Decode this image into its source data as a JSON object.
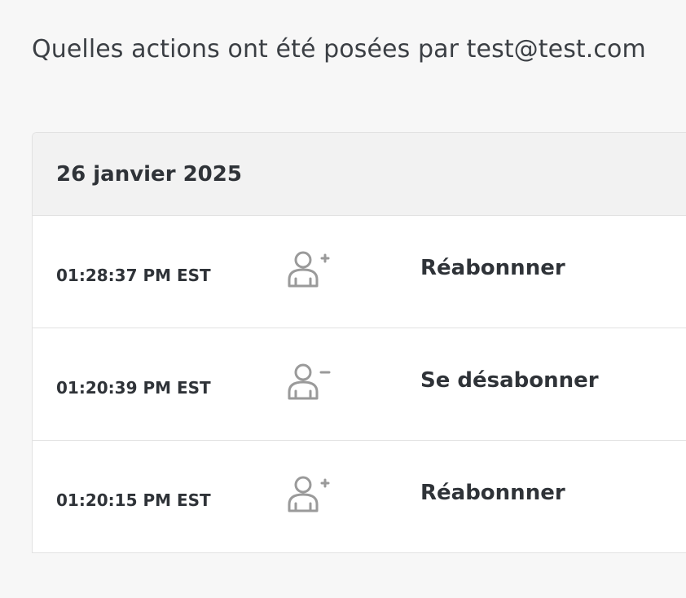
{
  "page": {
    "title": "Quelles actions ont été posées par test@test.com"
  },
  "log": {
    "date": "26 janvier 2025",
    "entries": [
      {
        "time": "01:28:37 PM EST",
        "icon": "user-plus-icon",
        "action": "Réabonnner"
      },
      {
        "time": "01:20:39 PM EST",
        "icon": "user-minus-icon",
        "action": "Se désabonner"
      },
      {
        "time": "01:20:15 PM EST",
        "icon": "user-plus-icon",
        "action": "Réabonnner"
      }
    ]
  },
  "colors": {
    "background": "#f7f7f7",
    "header_bg": "#f2f2f2",
    "border": "#e2e2e2",
    "text": "#2f3338",
    "icon": "#9a9a9a"
  }
}
